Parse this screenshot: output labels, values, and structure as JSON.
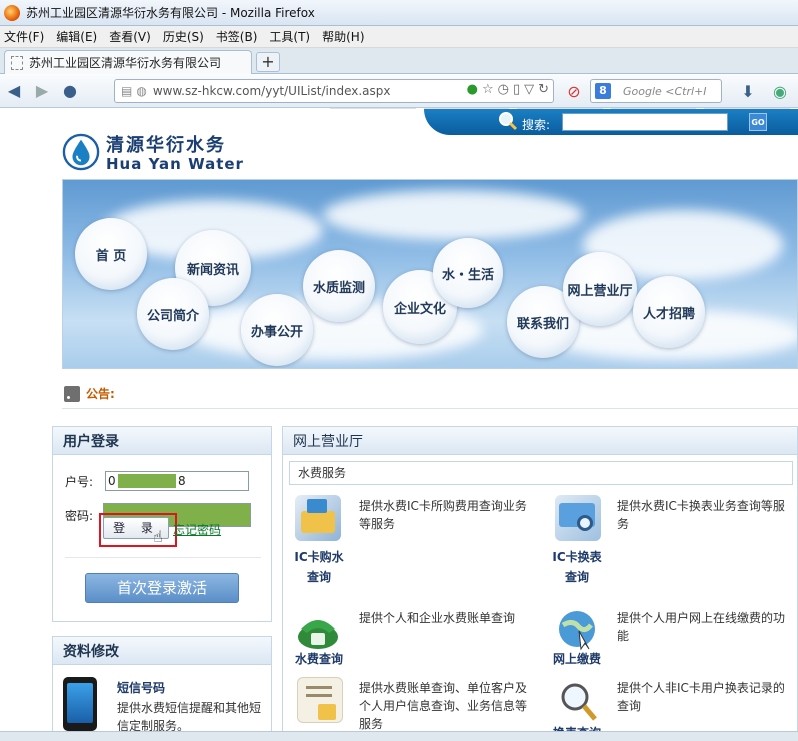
{
  "window": {
    "title": "苏州工业园区清源华衍水务有限公司 - Mozilla Firefox"
  },
  "menu": [
    "文件(F)",
    "编辑(E)",
    "查看(V)",
    "历史(S)",
    "书签(B)",
    "工具(T)",
    "帮助(H)"
  ],
  "tab": {
    "label": "苏州工业园区清源华衍水务有限公司",
    "new_tab_label": "+"
  },
  "address": {
    "url": "www.sz-hkcw.com/yyt/UIList/index.aspx"
  },
  "search_engine": {
    "placeholder": "Google <Ctrl+I"
  },
  "site": {
    "logo_cn": "清源华衍水务",
    "logo_en": "Hua Yan Water",
    "search_label": "搜索:",
    "go_label": "GO",
    "nav": [
      "首 页",
      "新闻资讯",
      "公司简介",
      "办事公开",
      "水质监测",
      "企业文化",
      "水・生活",
      "联系我们",
      "网上营业厅",
      "人才招聘"
    ],
    "notice_label": "公告:"
  },
  "login": {
    "heading": "用户登录",
    "account_label": "户号:",
    "account_prefix": "0",
    "account_suffix": "8",
    "password_label": "密码:",
    "login_button": "登 录",
    "forgot_link": "忘记密码",
    "activate_button": "首次登录激活"
  },
  "profile": {
    "heading": "资料修改",
    "sms_title": "短信号码",
    "sms_desc": "提供水费短信提醒和其他短信定制服务。"
  },
  "hall": {
    "heading": "网上营业厅",
    "subheading": "水费服务",
    "services": [
      {
        "title": "IC卡购水查询",
        "desc": "提供水费IC卡所购费用查询业务等服务",
        "icon": "ic-card-icon"
      },
      {
        "title": "IC卡换表查询",
        "desc": "提供水费IC卡换表业务查询等服务",
        "icon": "ic-card-search-icon"
      },
      {
        "title": "水费查询",
        "desc": "提供个人和企业水费账单查询",
        "icon": "phone-bill-icon"
      },
      {
        "title": "网上缴费",
        "desc": "提供个人用户网上在线缴费的功能",
        "icon": "globe-pay-icon"
      },
      {
        "title": "",
        "desc": "提供水费账单查询、单位客户及个人用户信息查询、业务信息等服务",
        "icon": "bill-doc-icon"
      },
      {
        "title": "换表查询",
        "desc": "提供个人非IC卡用户换表记录的查询",
        "icon": "magnifier-icon"
      }
    ]
  }
}
